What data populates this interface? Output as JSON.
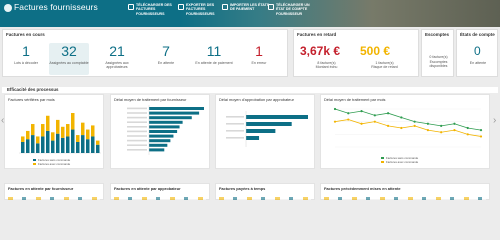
{
  "header": {
    "title": "Factures fournisseurs",
    "actions": [
      {
        "label": "Télécharger des factures fournisseurs",
        "icon": "download-icon"
      },
      {
        "label": "Exporter des factures fournisseurs",
        "icon": "export-icon"
      },
      {
        "label": "Importer les états de paiement",
        "icon": "import-icon"
      },
      {
        "label": "Télécharger un état de compte fournisseur",
        "icon": "document-icon"
      }
    ]
  },
  "kpis": {
    "title": "Factures en cours",
    "items": [
      {
        "value": "1",
        "label": "Lots à décoder"
      },
      {
        "value": "32",
        "label": "Assignées au comptable"
      },
      {
        "value": "21",
        "label": "Assignées aux approbateurs"
      },
      {
        "value": "7",
        "label": "En attente"
      },
      {
        "value": "11",
        "label": "En attente de paiement"
      },
      {
        "value": "1",
        "label": "En erreur"
      }
    ]
  },
  "late": {
    "title": "Factures en retard",
    "amount_due": "3,67k €",
    "amount_due_label": "8 facture(s)\nMontant échu",
    "amount_risk": "500 €",
    "amount_risk_label": "1 facture(s)\nRisque de retard"
  },
  "discounts": {
    "title": "Escomptes",
    "value": "0 facture(s)",
    "label": "Escomptes disponibles"
  },
  "account": {
    "title": "États de compte",
    "value": "0",
    "label": "En attente"
  },
  "process": {
    "title": "Efficacité des processus"
  },
  "charts": {
    "c1": {
      "title": "Factures vérifiées par mois"
    },
    "c2": {
      "title": "Délai moyen de traitement par fournisseur"
    },
    "c3": {
      "title": "Délai moyen d'approbation par approbateur"
    },
    "c4": {
      "title": "Délai moyen de traitement par mois"
    }
  },
  "bottom": [
    {
      "title": "Factures en attente par fournisseur"
    },
    {
      "title": "Factures en attente par approbateur"
    },
    {
      "title": "Factures payées à temps"
    },
    {
      "title": "Factures précédemment mises en attente"
    }
  ],
  "colors": {
    "primary": "#0d6f86",
    "accent": "#f2b400",
    "danger": "#c4202c",
    "green": "#2e9c4f"
  },
  "chart_data": [
    {
      "type": "bar",
      "title": "Factures vérifiées par mois",
      "categories": [
        "1",
        "2",
        "3",
        "4",
        "5",
        "6",
        "7",
        "8",
        "9",
        "10",
        "11",
        "12",
        "13",
        "14",
        "15",
        "16"
      ],
      "series": [
        {
          "name": "Factures sans commande",
          "values": [
            8,
            10,
            13,
            7,
            12,
            16,
            9,
            14,
            11,
            12,
            17,
            8,
            13,
            10,
            12,
            6
          ]
        },
        {
          "name": "Factures avec commande",
          "values": [
            4,
            6,
            8,
            5,
            9,
            11,
            6,
            10,
            8,
            9,
            12,
            5,
            9,
            7,
            8,
            3
          ]
        }
      ]
    },
    {
      "type": "bar",
      "title": "Délai moyen de traitement par fournisseur",
      "categories": [
        "",
        "",
        "",
        "",
        "",
        "",
        "",
        "",
        "",
        ""
      ],
      "values": [
        90,
        82,
        70,
        55,
        50,
        46,
        40,
        35,
        30,
        25
      ]
    },
    {
      "type": "bar",
      "title": "Délai moyen d'approbation par approbateur",
      "categories": [
        "",
        "",
        "",
        ""
      ],
      "values": [
        95,
        70,
        45,
        20
      ]
    },
    {
      "type": "line",
      "title": "Délai moyen de traitement par mois",
      "series": [
        {
          "name": "Factures sans commande",
          "values": [
            18,
            16,
            17,
            15,
            16,
            14,
            12,
            11,
            10,
            11,
            9,
            8
          ]
        },
        {
          "name": "Factures avec commande",
          "values": [
            12,
            13,
            11,
            12,
            10,
            9,
            10,
            8,
            7,
            8,
            6,
            5
          ]
        }
      ]
    }
  ]
}
